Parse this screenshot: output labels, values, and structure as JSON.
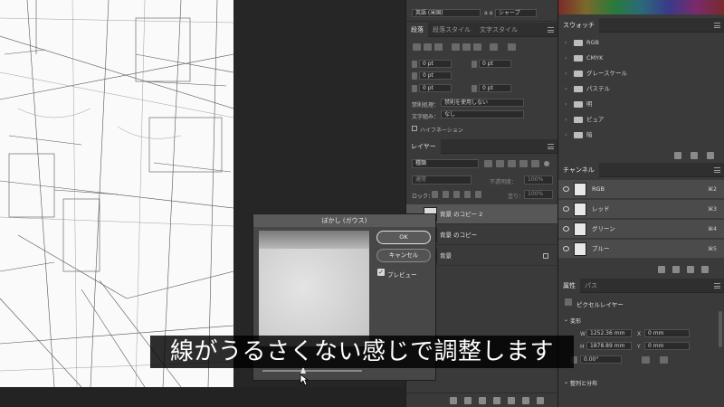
{
  "character": {
    "font_lang": "英語 (米国)",
    "aa_icon": "a a",
    "aa_mode": "シャープ"
  },
  "paragraph_panel": {
    "tabs": [
      "段落",
      "段落スタイル",
      "文字スタイル"
    ],
    "indent_left": "0 pt",
    "indent_right": "0 pt",
    "indent_first": "0 pt",
    "space_before": "0 pt",
    "space_after": "0 pt",
    "kinsoku_label": "禁則処理：",
    "kinsoku_value": "禁則を使用しない",
    "mojigumi_label": "文字組み：",
    "mojigumi_value": "なし",
    "hyphenation": "ハイフネーション"
  },
  "layers_panel": {
    "tab": "レイヤー",
    "search_placeholder": "種類",
    "blend_mode": "通常",
    "opacity_label": "不透明度：",
    "opacity_value": "100%",
    "lock_label": "ロック：",
    "fill_label": "塗り：",
    "fill_value": "100%",
    "layers": [
      {
        "name": "背景 のコピー 2"
      },
      {
        "name": "背景 のコピー"
      },
      {
        "name": "背景"
      }
    ]
  },
  "swatches_panel": {
    "tab": "スウォッチ",
    "folders": [
      "RGB",
      "CMYK",
      "グレースケール",
      "パステル",
      "明",
      "ピュア",
      "暗"
    ]
  },
  "channels_panel": {
    "tab": "チャンネル",
    "channels": [
      {
        "name": "RGB",
        "key": "⌘2"
      },
      {
        "name": "レッド",
        "key": "⌘3"
      },
      {
        "name": "グリーン",
        "key": "⌘4"
      },
      {
        "name": "ブルー",
        "key": "⌘5"
      }
    ]
  },
  "properties_panel": {
    "tabs": [
      "属性",
      "パス"
    ],
    "type": "ピクセルレイヤー",
    "transform_label": "変形",
    "w_label": "W",
    "w_value": "1252.36 mm",
    "h_label": "H",
    "h_value": "1878.89 mm",
    "x_label": "X",
    "x_value": "0 mm",
    "y_label": "Y",
    "y_value": "0 mm",
    "angle_value": "0.00°",
    "align_label": "整列と分布"
  },
  "dialog": {
    "title": "ぼかし (ガウス)",
    "ok": "OK",
    "cancel": "キャンセル",
    "preview_label": "プレビュー",
    "preview_checked": "✓"
  },
  "subtitle": "線がうるさくない感じで調整します"
}
